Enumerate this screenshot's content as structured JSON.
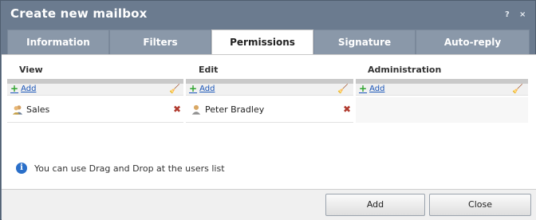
{
  "window": {
    "title": "Create new mailbox",
    "help_glyph": "?",
    "close_glyph": "×"
  },
  "tabs": [
    {
      "label": "Information",
      "active": false
    },
    {
      "label": "Filters",
      "active": false
    },
    {
      "label": "Permissions",
      "active": true
    },
    {
      "label": "Signature",
      "active": false
    },
    {
      "label": "Auto-reply",
      "active": false
    }
  ],
  "permissions": {
    "columns": [
      {
        "header": "View",
        "add_label": "Add",
        "items": [
          {
            "label": "Sales",
            "icon": "group-icon"
          }
        ]
      },
      {
        "header": "Edit",
        "add_label": "Add",
        "items": [
          {
            "label": "Peter Bradley",
            "icon": "user-icon"
          }
        ]
      },
      {
        "header": "Administration",
        "add_label": "Add",
        "items": []
      }
    ],
    "info_text": "You can use Drag and Drop at the users list"
  },
  "footer": {
    "add_label": "Add",
    "close_label": "Close"
  },
  "colors": {
    "title_bar": "#6b7b8f",
    "tab_inactive": "#8a98a9",
    "link": "#1a55b8",
    "remove": "#b03a2e"
  }
}
